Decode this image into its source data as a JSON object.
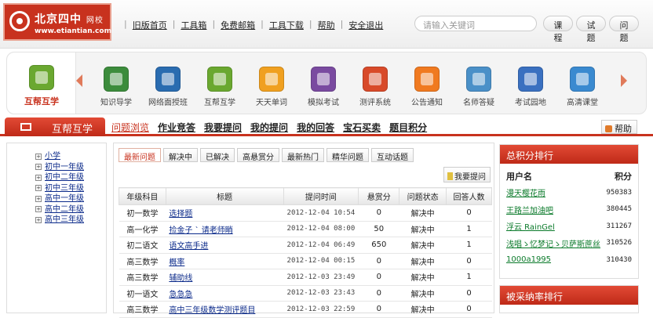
{
  "header": {
    "logo": {
      "cn": "北京四中",
      "cn_small": "网校",
      "url": "www.etiantian.com"
    },
    "nav": [
      "旧版首页",
      "工具箱",
      "免费邮箱",
      "工具下载",
      "帮助",
      "安全退出"
    ],
    "search_placeholder": "请输入关键词",
    "search_buttons": [
      "课程",
      "试题",
      "问题"
    ]
  },
  "iconbar": {
    "main": {
      "label": "互帮互学",
      "icon": "people-icon"
    },
    "items": [
      {
        "label": "知识导学",
        "icon": "pencil-book-icon",
        "color": "#3c8c3c"
      },
      {
        "label": "网络面授班",
        "icon": "classroom-icon",
        "color": "#2a6cb0"
      },
      {
        "label": "互帮互学",
        "icon": "people-icon",
        "color": "#6aa830"
      },
      {
        "label": "天天单词",
        "icon": "word-badge-icon",
        "color": "#f0a020"
      },
      {
        "label": "模拟考试",
        "icon": "exam-icon",
        "color": "#7a4aa0"
      },
      {
        "label": "测评系统",
        "icon": "chart-icon",
        "color": "#d84a2a"
      },
      {
        "label": "公告通知",
        "icon": "rss-icon",
        "color": "#f07a20"
      },
      {
        "label": "名师答疑",
        "icon": "teacher-icon",
        "color": "#4a90c8"
      },
      {
        "label": "考试园地",
        "icon": "notes-icon",
        "color": "#3a70c0"
      },
      {
        "label": "高清课堂",
        "icon": "monitor-icon",
        "color": "#3a8ad0"
      }
    ]
  },
  "section": {
    "title": "互帮互学",
    "nav": [
      "问题浏览",
      "作业竞答",
      "我要提问",
      "我的提问",
      "我的回答",
      "宝石买卖",
      "题目积分"
    ],
    "active": "问题浏览",
    "help": "帮助"
  },
  "tree": [
    {
      "label": "小学"
    },
    {
      "label": "初中一年级"
    },
    {
      "label": "初中二年级"
    },
    {
      "label": "初中三年级"
    },
    {
      "label": "高中一年级"
    },
    {
      "label": "高中二年级"
    },
    {
      "label": "高中三年级"
    }
  ],
  "questions": {
    "tabs": [
      "最新问题",
      "解决中",
      "已解决",
      "高悬赏分",
      "最新热门",
      "精华问题",
      "互动话题"
    ],
    "active_tab": "最新问题",
    "ask_button": "我要提问",
    "columns": [
      "年级科目",
      "标题",
      "提问时间",
      "悬赏分",
      "问题状态",
      "回答人数"
    ],
    "rows": [
      [
        "初一数学",
        "选择题",
        "2012-12-04 10:54",
        "0",
        "解决中",
        "0"
      ],
      [
        "高一化学",
        "捡金子 ` 请老师睄",
        "2012-12-04 08:00",
        "50",
        "解决中",
        "1"
      ],
      [
        "初二语文",
        "语文高手进",
        "2012-12-04 06:49",
        "650",
        "解决中",
        "1"
      ],
      [
        "高三数学",
        "概率",
        "2012-12-04 00:15",
        "0",
        "解决中",
        "0"
      ],
      [
        "高三数学",
        "辅助线",
        "2012-12-03 23:49",
        "0",
        "解决中",
        "1"
      ],
      [
        "初一语文",
        "急急急",
        "2012-12-03 23:43",
        "0",
        "解决中",
        "0"
      ],
      [
        "高三数学",
        "高中三年级数学测评题目",
        "2012-12-03 22:59",
        "0",
        "解决中",
        "0"
      ]
    ]
  },
  "ranking": {
    "title": "总积分排行",
    "col_user": "用户名",
    "col_score": "积分",
    "rows": [
      {
        "user": "漫天樱花雨",
        "score": "950383"
      },
      {
        "user": "王路兰加油吧",
        "score": "380445"
      },
      {
        "user": "浮云 RainGel",
        "score": "311267"
      },
      {
        "user": "浅唱ゝ忆梦记ゝ贝萨斯蔗丝",
        "score": "310526"
      },
      {
        "user": "1000a1995",
        "score": "310430"
      }
    ]
  },
  "adoption": {
    "title": "被采纳率排行"
  }
}
